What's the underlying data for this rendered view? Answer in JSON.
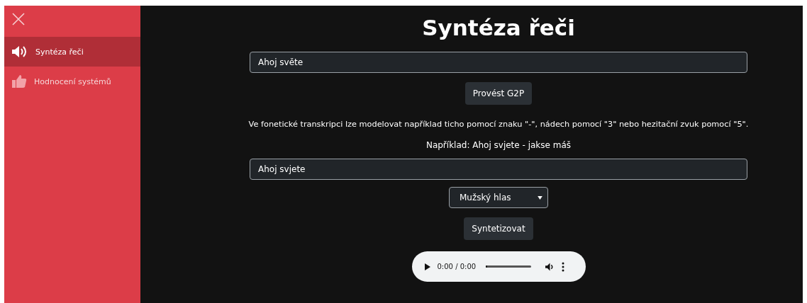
{
  "sidebar": {
    "items": [
      {
        "label": "Syntéza řeči",
        "selected": true
      },
      {
        "label": "Hodnocení systémů",
        "selected": false
      }
    ]
  },
  "title": "Syntéza řeči",
  "text_field": {
    "value": "Ahoj světe"
  },
  "g2p_button": "Provést G2P",
  "hint": "Ve fonetické transkripci lze modelovat například ticho pomocí znaku \"-\", nádech pomocí \"3\" nebo hezitační zvuk pomocí \"5\".",
  "example": "Například: Ahoj svjete - jakse máš",
  "phonetic_field": {
    "value": "Ahoj svjete"
  },
  "voice_select": {
    "value": "Mužský hlas"
  },
  "synth_button": "Syntetizovat",
  "audio": {
    "time": "0:00 / 0:00",
    "level": 0
  }
}
